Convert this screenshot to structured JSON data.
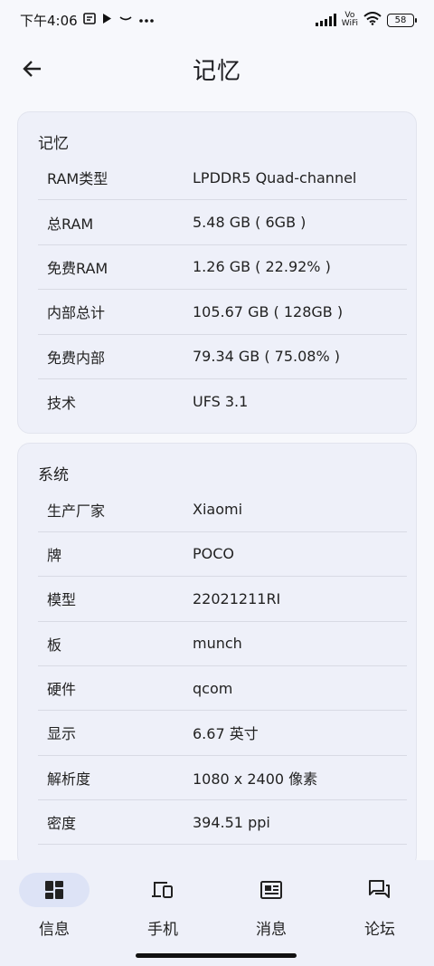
{
  "status_bar": {
    "time": "下午4:06",
    "volte_top": "Vo",
    "volte_bottom": "WiFi",
    "battery": "58"
  },
  "header": {
    "title": "记忆"
  },
  "memory_card": {
    "title": "记忆",
    "rows": [
      {
        "label": "RAM类型",
        "value": "LPDDR5 Quad-channel"
      },
      {
        "label": "总RAM",
        "value": "5.48 GB ( 6GB )"
      },
      {
        "label": "免费RAM",
        "value": "1.26 GB ( 22.92% )"
      },
      {
        "label": "内部总计",
        "value": "105.67 GB ( 128GB )"
      },
      {
        "label": "免费内部",
        "value": "79.34 GB ( 75.08% )"
      },
      {
        "label": "技术",
        "value": "UFS 3.1"
      }
    ]
  },
  "system_card": {
    "title": "系统",
    "rows": [
      {
        "label": "生产厂家",
        "value": "Xiaomi"
      },
      {
        "label": "牌",
        "value": "POCO"
      },
      {
        "label": "模型",
        "value": "22021211RI"
      },
      {
        "label": "板",
        "value": "munch"
      },
      {
        "label": "硬件",
        "value": "qcom"
      },
      {
        "label": "显示",
        "value": "6.67 英寸"
      },
      {
        "label": "解析度",
        "value": "1080 x 2400 像素"
      },
      {
        "label": "密度",
        "value": "394.51 ppi"
      }
    ]
  },
  "bottom_nav": {
    "items": [
      {
        "label": "信息",
        "icon": "dashboard-icon"
      },
      {
        "label": "手机",
        "icon": "devices-icon"
      },
      {
        "label": "消息",
        "icon": "newspaper-icon"
      },
      {
        "label": "论坛",
        "icon": "forum-icon"
      }
    ]
  }
}
